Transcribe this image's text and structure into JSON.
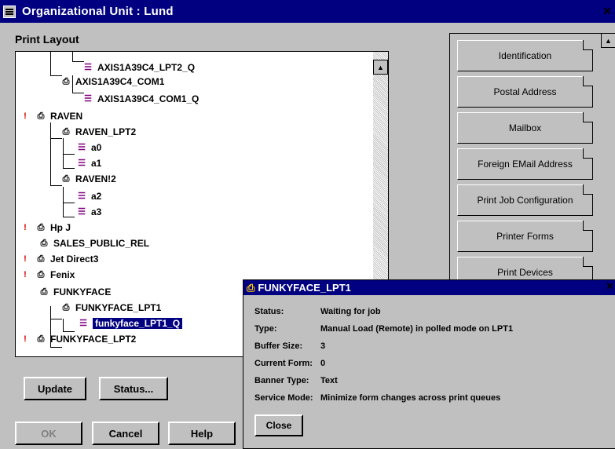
{
  "window": {
    "title": "Organizational Unit : Lund"
  },
  "print_layout_label": "Print Layout",
  "tree": [
    {
      "label": "AXIS1A39C4_LPT2_Q",
      "icon": "queue-icon"
    },
    {
      "label": "AXIS1A39C4_COM1",
      "icon": "printer-icon"
    },
    {
      "label": "AXIS1A39C4_COM1_Q",
      "icon": "queue-icon"
    },
    {
      "label": "RAVEN",
      "icon": "printer-alert-icon"
    },
    {
      "label": "RAVEN_LPT2",
      "icon": "printer-icon"
    },
    {
      "label": "a0",
      "icon": "queue-icon"
    },
    {
      "label": "a1",
      "icon": "queue-icon"
    },
    {
      "label": "RAVEN!2",
      "icon": "printer-icon"
    },
    {
      "label": "a2",
      "icon": "queue-icon"
    },
    {
      "label": "a3",
      "icon": "queue-icon"
    },
    {
      "label": "Hp J",
      "icon": "printer-alert-icon"
    },
    {
      "label": "SALES_PUBLIC_REL",
      "icon": "printer-icon"
    },
    {
      "label": "Jet Direct3",
      "icon": "printer-alert-icon"
    },
    {
      "label": "Fenix",
      "icon": "printer-alert-icon"
    },
    {
      "label": "FUNKYFACE",
      "icon": "printer-icon"
    },
    {
      "label": "FUNKYFACE_LPT1",
      "icon": "printer-icon"
    },
    {
      "label": "funkyface_LPT1_Q",
      "icon": "queue-icon",
      "selected": true
    },
    {
      "label": "FUNKYFACE_LPT2",
      "icon": "printer-alert-icon"
    }
  ],
  "buttons": {
    "update": "Update",
    "status": "Status...",
    "ok": "OK",
    "cancel": "Cancel",
    "help": "Help"
  },
  "right_panel": [
    "Identification",
    "Postal Address",
    "Mailbox",
    "Foreign EMail Address",
    "Print Job Configuration",
    "Printer Forms",
    "Print Devices"
  ],
  "popup": {
    "title": "FUNKYFACE_LPT1",
    "rows": [
      {
        "key": "Status:",
        "value": "Waiting for job"
      },
      {
        "key": "Type:",
        "value": "Manual Load (Remote) in polled mode on LPT1"
      },
      {
        "key": "Buffer Size:",
        "value": "3"
      },
      {
        "key": "Current Form:",
        "value": "0"
      },
      {
        "key": "Banner Type:",
        "value": "Text"
      },
      {
        "key": "Service Mode:",
        "value": "Minimize form changes across print queues"
      }
    ],
    "close_label": "Close"
  },
  "colors": {
    "titlebar": "#000080",
    "selection": "#000080",
    "window_bg": "#c0c0c0"
  }
}
